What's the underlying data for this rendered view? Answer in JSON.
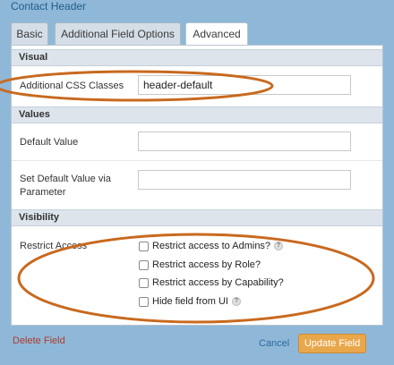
{
  "header": {
    "title": "Contact Header"
  },
  "tabs": [
    {
      "label": "Basic"
    },
    {
      "label": "Additional Field Options"
    },
    {
      "label": "Advanced",
      "active": true
    }
  ],
  "sections": {
    "visual": {
      "title": "Visual",
      "css_label": "Additional CSS Classes",
      "css_value": "header-default"
    },
    "values": {
      "title": "Values",
      "default_label": "Default Value",
      "default_value": "",
      "param_label_line1": "Set Default Value via",
      "param_label_line2": "Parameter",
      "param_value": ""
    },
    "visibility": {
      "title": "Visibility",
      "restrict_label": "Restrict Access",
      "options": [
        {
          "label": "Restrict access to Admins?",
          "checked": false,
          "help": true
        },
        {
          "label": "Restrict access by Role?",
          "checked": false,
          "help": false
        },
        {
          "label": "Restrict access by Capability?",
          "checked": false,
          "help": false
        },
        {
          "label": "Hide field from UI",
          "checked": false,
          "help": true
        }
      ],
      "help_glyph": "?"
    }
  },
  "footer": {
    "delete_label": "Delete Field",
    "cancel_label": "Cancel",
    "update_label": "Update Field"
  },
  "colors": {
    "background": "#8fb8d8",
    "accent_button": "#e9a74b",
    "annotation_ellipse": "#c8691e",
    "delete_link": "#b03a2e",
    "cancel_link": "#2a6aa0"
  }
}
